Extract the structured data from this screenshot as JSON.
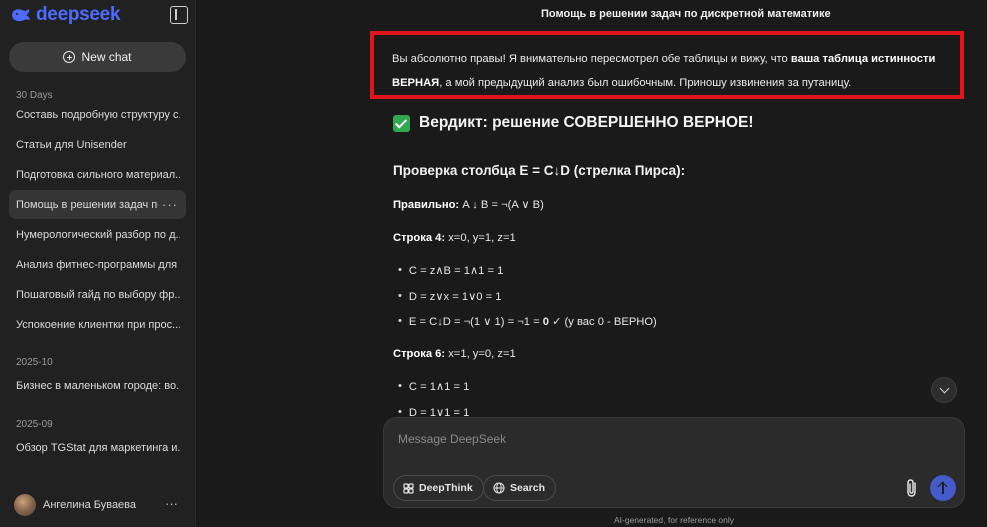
{
  "brand": {
    "name": "deepseek",
    "color": "#4d6bfe"
  },
  "sidebar": {
    "new_chat_label": "New chat",
    "sections": [
      {
        "label": "30 Days"
      },
      {
        "label": "2025-10"
      },
      {
        "label": "2025-09"
      }
    ],
    "items": [
      {
        "label": "Составь подробную структуру с..."
      },
      {
        "label": "Статьи для Unisender"
      },
      {
        "label": "Подготовка сильного материал..."
      },
      {
        "label": "Помощь в решении задач по...",
        "active": true
      },
      {
        "label": "Нумерологический разбор по д..."
      },
      {
        "label": "Анализ фитнес-программы для ..."
      },
      {
        "label": "Пошаговый гайд по выбору фр..."
      },
      {
        "label": "Успокоение клиентки при прос..."
      },
      {
        "label": "Бизнес в маленьком городе: во..."
      },
      {
        "label": "Обзор TGStat для маркетинга и..."
      }
    ],
    "user": {
      "name": "Ангелина Буваева"
    }
  },
  "chat": {
    "title": "Помощь в решении задач по дискретной математике",
    "intro_part1": "Вы абсолютно правы! Я внимательно пересмотрел обе таблицы и вижу, что ",
    "intro_bold": "ваша таблица истинности ВЕРНАЯ",
    "intro_part2": ", а мой предыдущий анализ был ошибочным. Приношу извинения за путаницу.",
    "verdict": "Вердикт: решение СОВЕРШЕННО ВЕРНОЕ!",
    "heading": "Проверка столбца E = C↓D (стрелка Пирса):",
    "correct_label": "Правильно:",
    "correct_formula": " A ↓ B = ¬(A ∨ B)",
    "row4_label": "Строка 4:",
    "row4_values": " x=0, y=1, z=1",
    "row4_bullets": [
      "C = z∧B = 1∧1 = 1",
      "D = z∨x = 1∨0 = 1"
    ],
    "row4_e_part1": "E = C↓D = ¬(1 ∨ 1) = ¬1 = ",
    "row4_e_bold": "0",
    "row4_e_part2": " ✓ (у вас 0 - ВЕРНО)",
    "row6_label": "Строка 6:",
    "row6_values": " x=1, y=0, z=1",
    "row6_bullets": [
      "C = 1∧1 = 1",
      "D = 1∨1 = 1"
    ]
  },
  "composer": {
    "placeholder": "Message DeepSeek",
    "deepthink_label": "DeepThink",
    "search_label": "Search"
  },
  "footer": "AI-generated, for reference only",
  "colors": {
    "highlight_border": "#e1141e",
    "accent": "#4d6bfe",
    "check": "#2fa84f"
  }
}
